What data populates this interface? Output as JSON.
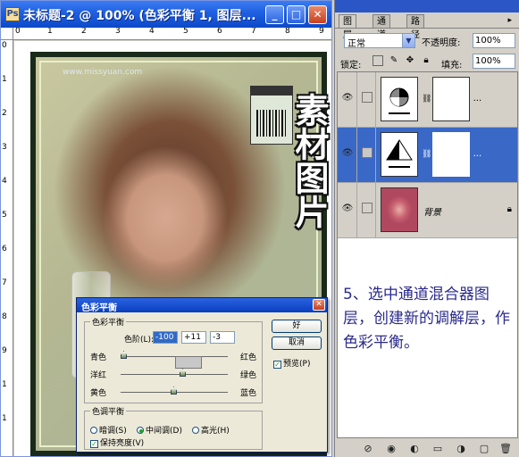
{
  "document": {
    "title": "未标题-2 @ 100% (色彩平衡 1, 图层...",
    "window_buttons": {
      "minimize": "_",
      "maximize": "□",
      "close": "✕"
    },
    "ruler_top_numbers": [
      "0",
      "1",
      "2",
      "3",
      "4",
      "5",
      "6",
      "7",
      "8",
      "9"
    ],
    "ruler_left_numbers": [
      "0",
      "1",
      "2",
      "3",
      "4",
      "5",
      "6",
      "7",
      "8",
      "9",
      "1",
      "1"
    ],
    "watermark": "www.missyuan.com",
    "photo_overlay_text": "素材图片"
  },
  "color_balance_dialog": {
    "title": "色彩平衡",
    "close_glyph": "✕",
    "balance_group_label": "色彩平衡",
    "levels_label": "色阶(L):",
    "levels": [
      "-100",
      "+11",
      "-3"
    ],
    "sliders": [
      {
        "left": "青色",
        "right": "红色",
        "value": -100
      },
      {
        "left": "洋红",
        "right": "绿色",
        "value": 11
      },
      {
        "left": "黄色",
        "right": "蓝色",
        "value": -3
      }
    ],
    "tone_group_label": "色调平衡",
    "tone_options": [
      {
        "label": "暗调(S)",
        "selected": false
      },
      {
        "label": "中间调(D)",
        "selected": true
      },
      {
        "label": "高光(H)",
        "selected": false
      }
    ],
    "preserve_luminosity_label": "保持亮度(V)",
    "preserve_luminosity_checked": true,
    "ok_label": "好",
    "cancel_label": "取消",
    "preview_label": "预览(P)",
    "preview_checked": true
  },
  "layers_panel": {
    "tabs": [
      {
        "label": "图层",
        "active": true
      },
      {
        "label": "通道",
        "active": false
      },
      {
        "label": "路径",
        "active": false
      }
    ],
    "menu_arrow": "▸",
    "blend_mode": "正常",
    "opacity_label": "不透明度:",
    "opacity_value": "100%",
    "lock_label": "锁定:",
    "fill_label": "填充:",
    "fill_value": "100%",
    "layers": [
      {
        "name": "...",
        "type": "adjustment",
        "selected": false,
        "has_mask": true
      },
      {
        "name": "...",
        "type": "adjustment",
        "selected": true,
        "has_mask": true
      },
      {
        "name": "背景",
        "type": "image",
        "selected": false,
        "has_mask": false
      }
    ],
    "tutorial_text": "5、选中通道混合器图层，创建新的调解层，作色彩平衡。",
    "accent_color": "#3a68c6"
  }
}
